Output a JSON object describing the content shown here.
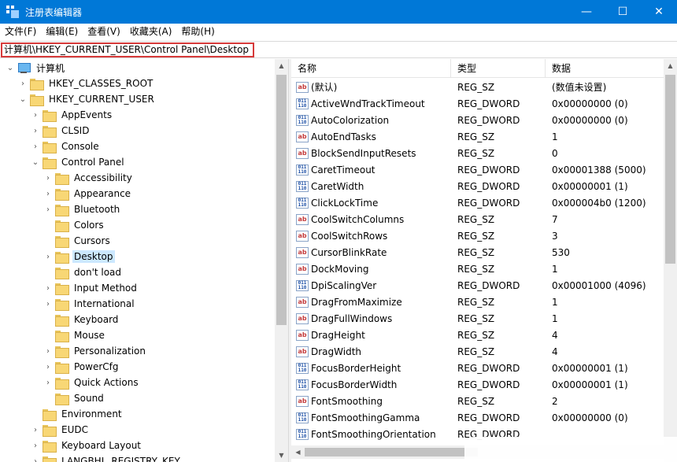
{
  "window": {
    "title": "注册表编辑器",
    "controls": {
      "minimize": "—",
      "maximize": "☐",
      "close": "✕"
    }
  },
  "menu": [
    {
      "label": "文件(F)"
    },
    {
      "label": "编辑(E)"
    },
    {
      "label": "查看(V)"
    },
    {
      "label": "收藏夹(A)"
    },
    {
      "label": "帮助(H)"
    }
  ],
  "address": {
    "path": "计算机\\HKEY_CURRENT_USER\\Control Panel\\Desktop"
  },
  "tree": [
    {
      "label": "计算机",
      "level": 0,
      "expander": "expanded",
      "icon": "computer-icon"
    },
    {
      "label": "HKEY_CLASSES_ROOT",
      "level": 1,
      "expander": "collapsed",
      "icon": "folder-icon"
    },
    {
      "label": "HKEY_CURRENT_USER",
      "level": 1,
      "expander": "expanded",
      "icon": "folder-icon"
    },
    {
      "label": "AppEvents",
      "level": 2,
      "expander": "collapsed",
      "icon": "folder-icon"
    },
    {
      "label": "CLSID",
      "level": 2,
      "expander": "collapsed",
      "icon": "folder-icon"
    },
    {
      "label": "Console",
      "level": 2,
      "expander": "collapsed",
      "icon": "folder-icon"
    },
    {
      "label": "Control Panel",
      "level": 2,
      "expander": "expanded",
      "icon": "folder-icon"
    },
    {
      "label": "Accessibility",
      "level": 3,
      "expander": "collapsed",
      "icon": "folder-icon"
    },
    {
      "label": "Appearance",
      "level": 3,
      "expander": "collapsed",
      "icon": "folder-icon"
    },
    {
      "label": "Bluetooth",
      "level": 3,
      "expander": "collapsed",
      "icon": "folder-icon"
    },
    {
      "label": "Colors",
      "level": 3,
      "expander": "none",
      "icon": "folder-icon"
    },
    {
      "label": "Cursors",
      "level": 3,
      "expander": "none",
      "icon": "folder-icon"
    },
    {
      "label": "Desktop",
      "level": 3,
      "expander": "collapsed",
      "icon": "folder-icon",
      "selected": true
    },
    {
      "label": "don't load",
      "level": 3,
      "expander": "none",
      "icon": "folder-icon"
    },
    {
      "label": "Input Method",
      "level": 3,
      "expander": "collapsed",
      "icon": "folder-icon"
    },
    {
      "label": "International",
      "level": 3,
      "expander": "collapsed",
      "icon": "folder-icon"
    },
    {
      "label": "Keyboard",
      "level": 3,
      "expander": "none",
      "icon": "folder-icon"
    },
    {
      "label": "Mouse",
      "level": 3,
      "expander": "none",
      "icon": "folder-icon"
    },
    {
      "label": "Personalization",
      "level": 3,
      "expander": "collapsed",
      "icon": "folder-icon"
    },
    {
      "label": "PowerCfg",
      "level": 3,
      "expander": "collapsed",
      "icon": "folder-icon"
    },
    {
      "label": "Quick Actions",
      "level": 3,
      "expander": "collapsed",
      "icon": "folder-icon"
    },
    {
      "label": "Sound",
      "level": 3,
      "expander": "none",
      "icon": "folder-icon"
    },
    {
      "label": "Environment",
      "level": 2,
      "expander": "none",
      "icon": "folder-icon"
    },
    {
      "label": "EUDC",
      "level": 2,
      "expander": "collapsed",
      "icon": "folder-icon"
    },
    {
      "label": "Keyboard Layout",
      "level": 2,
      "expander": "collapsed",
      "icon": "folder-icon"
    },
    {
      "label": "LANGBHL_REGISTRY_KEY",
      "level": 2,
      "expander": "collapsed",
      "icon": "folder-icon"
    }
  ],
  "list": {
    "columns": {
      "name": "名称",
      "type": "类型",
      "data": "数据"
    },
    "rows": [
      {
        "name": "(默认)",
        "type": "REG_SZ",
        "data": "(数值未设置)",
        "kind": "sz"
      },
      {
        "name": "ActiveWndTrackTimeout",
        "type": "REG_DWORD",
        "data": "0x00000000 (0)",
        "kind": "dw"
      },
      {
        "name": "AutoColorization",
        "type": "REG_DWORD",
        "data": "0x00000000 (0)",
        "kind": "dw"
      },
      {
        "name": "AutoEndTasks",
        "type": "REG_SZ",
        "data": "1",
        "kind": "sz"
      },
      {
        "name": "BlockSendInputResets",
        "type": "REG_SZ",
        "data": "0",
        "kind": "sz"
      },
      {
        "name": "CaretTimeout",
        "type": "REG_DWORD",
        "data": "0x00001388 (5000)",
        "kind": "dw"
      },
      {
        "name": "CaretWidth",
        "type": "REG_DWORD",
        "data": "0x00000001 (1)",
        "kind": "dw"
      },
      {
        "name": "ClickLockTime",
        "type": "REG_DWORD",
        "data": "0x000004b0 (1200)",
        "kind": "dw"
      },
      {
        "name": "CoolSwitchColumns",
        "type": "REG_SZ",
        "data": "7",
        "kind": "sz"
      },
      {
        "name": "CoolSwitchRows",
        "type": "REG_SZ",
        "data": "3",
        "kind": "sz"
      },
      {
        "name": "CursorBlinkRate",
        "type": "REG_SZ",
        "data": "530",
        "kind": "sz"
      },
      {
        "name": "DockMoving",
        "type": "REG_SZ",
        "data": "1",
        "kind": "sz"
      },
      {
        "name": "DpiScalingVer",
        "type": "REG_DWORD",
        "data": "0x00001000 (4096)",
        "kind": "dw"
      },
      {
        "name": "DragFromMaximize",
        "type": "REG_SZ",
        "data": "1",
        "kind": "sz"
      },
      {
        "name": "DragFullWindows",
        "type": "REG_SZ",
        "data": "1",
        "kind": "sz"
      },
      {
        "name": "DragHeight",
        "type": "REG_SZ",
        "data": "4",
        "kind": "sz"
      },
      {
        "name": "DragWidth",
        "type": "REG_SZ",
        "data": "4",
        "kind": "sz"
      },
      {
        "name": "FocusBorderHeight",
        "type": "REG_DWORD",
        "data": "0x00000001 (1)",
        "kind": "dw"
      },
      {
        "name": "FocusBorderWidth",
        "type": "REG_DWORD",
        "data": "0x00000001 (1)",
        "kind": "dw"
      },
      {
        "name": "FontSmoothing",
        "type": "REG_SZ",
        "data": "2",
        "kind": "sz"
      },
      {
        "name": "FontSmoothingGamma",
        "type": "REG_DWORD",
        "data": "0x00000000 (0)",
        "kind": "dw"
      },
      {
        "name": "FontSmoothingOrientation",
        "type": "REG_DWORD",
        "data": "",
        "kind": "dw"
      }
    ]
  },
  "icons": {
    "sz_glyph": "ab",
    "dw_glyph": "011\n110"
  },
  "colors": {
    "titlebar": "#0078d7",
    "selection": "#cce8ff",
    "highlight_border": "#d63a3a"
  }
}
